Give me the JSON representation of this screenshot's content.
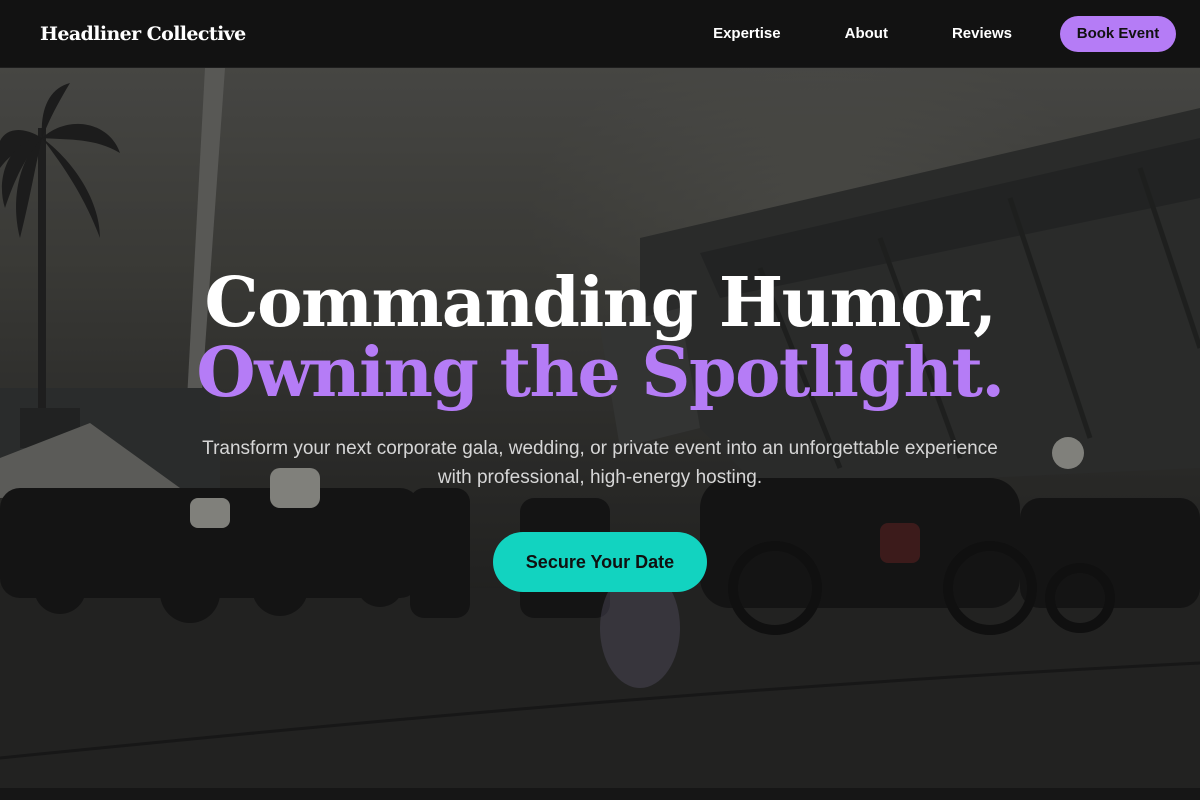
{
  "nav": {
    "brand": "Headliner Collective",
    "links": [
      {
        "label": "Expertise"
      },
      {
        "label": "About"
      },
      {
        "label": "Reviews"
      }
    ],
    "cta_label": "Book Event"
  },
  "hero": {
    "headline_line1": "Commanding Humor,",
    "headline_line2": "Owning the Spotlight.",
    "subtext": "Transform your next corporate gala, wedding, or private event into an unforgettable experience with professional, high-energy hosting.",
    "cta_label": "Secure Your Date",
    "background_image": "stadium-motorcycles-photo"
  },
  "colors": {
    "accent_purple": "#b57cf6",
    "accent_teal": "#12d3c0",
    "nav_background": "#121212"
  }
}
